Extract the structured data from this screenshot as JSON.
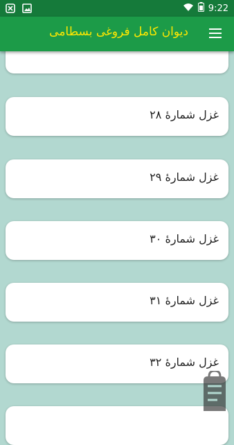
{
  "status_bar": {
    "time": "9:22",
    "icons": [
      "shield-notification-icon",
      "image-notification-icon",
      "wifi-icon",
      "battery-icon"
    ]
  },
  "app_bar": {
    "title": "دیوان کامل فروغی بسطامی",
    "title_color": "#ffe800",
    "background": "#1c9b48",
    "menu_icon": "hamburger-menu-icon"
  },
  "list": {
    "items": [
      {
        "label": ""
      },
      {
        "label": "غزل شمارهٔ ۲۸"
      },
      {
        "label": "غزل شمارهٔ ۲۹"
      },
      {
        "label": "غزل شمارهٔ ۳۰"
      },
      {
        "label": "غزل شمارهٔ ۳۱"
      },
      {
        "label": "غزل شمارهٔ ۳۲"
      },
      {
        "label": ""
      }
    ]
  },
  "colors": {
    "page_background": "#b2d8d0",
    "status_bar": "#157a3a",
    "card": "#ffffff"
  },
  "watermark": {
    "icon": "store-logo-icon"
  }
}
